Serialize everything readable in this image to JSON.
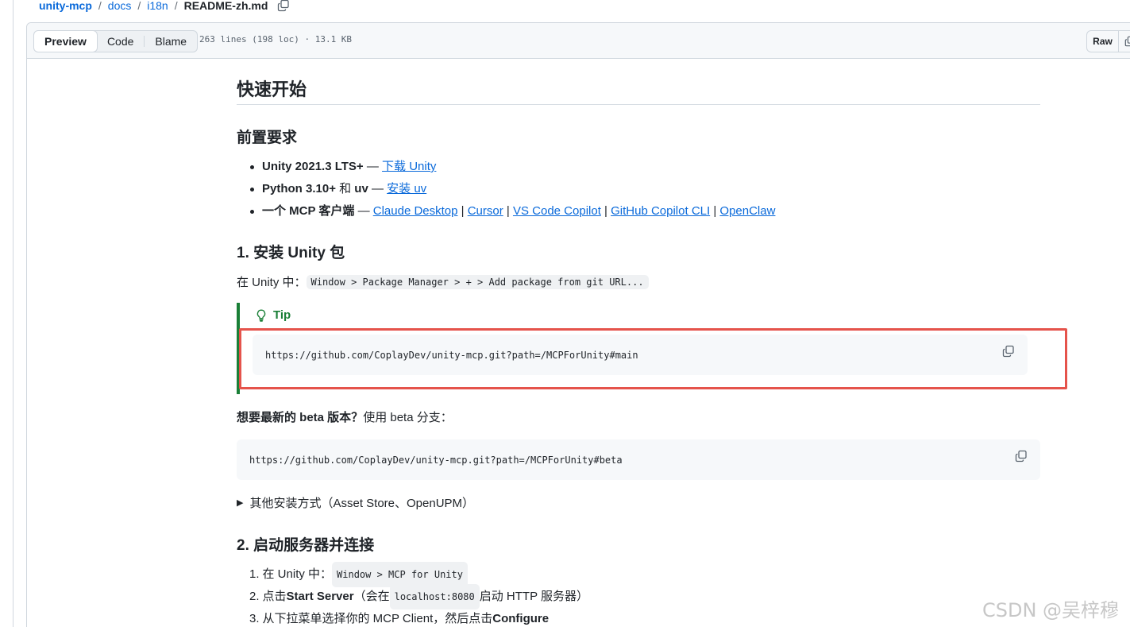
{
  "breadcrumb": {
    "repo": "unity-mcp",
    "folder1": "docs",
    "folder2": "i18n",
    "file": "README-zh.md"
  },
  "file_header": {
    "tabs": [
      "Preview",
      "Code",
      "Blame"
    ],
    "active_tab": "Preview",
    "meta": "263 lines (198 loc) · 13.1 KB",
    "raw_label": "Raw"
  },
  "content": {
    "h2_title": "快速开始",
    "prereq_title": "前置要求",
    "prereq": [
      {
        "bold": "Unity 2021.3 LTS+",
        "sep": " — ",
        "link": "下载 Unity"
      },
      {
        "bold": "Python 3.10+",
        "mid": " 和 ",
        "bold2": "uv",
        "sep": " — ",
        "link": "安装 uv"
      },
      {
        "bold": "一个 MCP 客户端",
        "sep": " — ",
        "links": [
          "Claude Desktop",
          "Cursor",
          "VS Code Copilot",
          "GitHub Copilot CLI",
          "OpenClaw"
        ],
        "pipe": " | "
      }
    ],
    "step1_title": "1. 安装 Unity 包",
    "step1_text": "在 Unity 中：",
    "step1_code": "Window > Package Manager > + > Add package from git URL...",
    "tip_label": "Tip",
    "tip_code": "https://github.com/CoplayDev/unity-mcp.git?path=/MCPForUnity#main",
    "beta_bold": "想要最新的 beta 版本？",
    "beta_text": " 使用 beta 分支：",
    "beta_code": "https://github.com/CoplayDev/unity-mcp.git?path=/MCPForUnity#beta",
    "details_summary": "其他安装方式（Asset Store、OpenUPM）",
    "step2_title": "2. 启动服务器并连接",
    "step2_items": [
      {
        "num": "1.",
        "pre": "在 Unity 中：",
        "code": "Window > MCP for Unity"
      },
      {
        "num": "2.",
        "pre": "点击 ",
        "bold": "Start Server",
        "mid": "（会在 ",
        "code": "localhost:8080",
        "post": " 启动 HTTP 服务器）"
      },
      {
        "num": "3.",
        "pre": "从下拉菜单选择你的 MCP Client，然后点击 ",
        "bold": "Configure"
      }
    ]
  },
  "watermark": "CSDN @吴梓穆",
  "colors": {
    "link": "#0969da",
    "tip": "#1a7f37",
    "highlight": "#e5534b"
  }
}
